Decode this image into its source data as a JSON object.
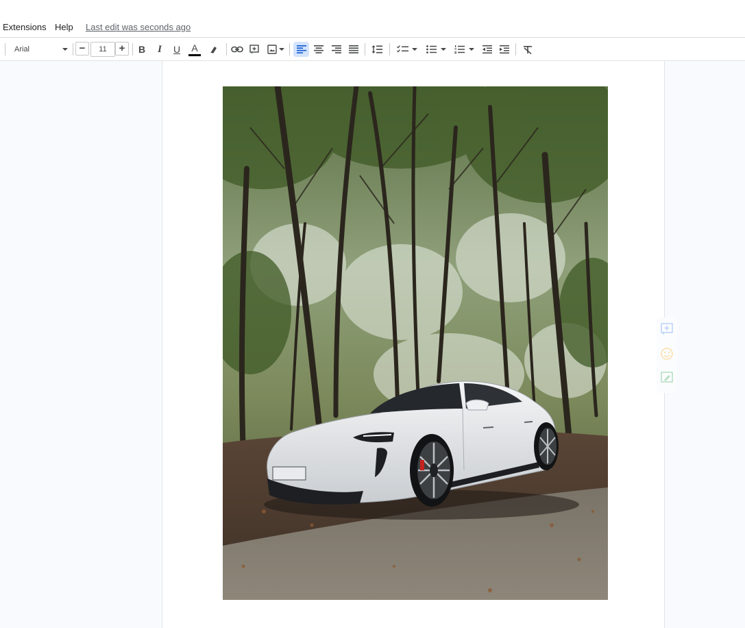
{
  "menu": {
    "items": [
      "Extensions",
      "Help"
    ],
    "last_edit": "Last edit was seconds ago"
  },
  "toolbar": {
    "font": "Arial",
    "size": "11",
    "decrease_label": "−",
    "increase_label": "+",
    "bold_label": "B",
    "italic_label": "I",
    "underline_label": "U",
    "text_color_label": "A",
    "active_alignment": "left",
    "text_color": "#000000",
    "accent_color": "#d3e3fd"
  },
  "document": {
    "image": "photo of a white sports car parked on a forest road beneath tall trees"
  },
  "side_tools": [
    "add-comment-icon",
    "emoji-reaction-icon",
    "suggest-edits-icon"
  ]
}
